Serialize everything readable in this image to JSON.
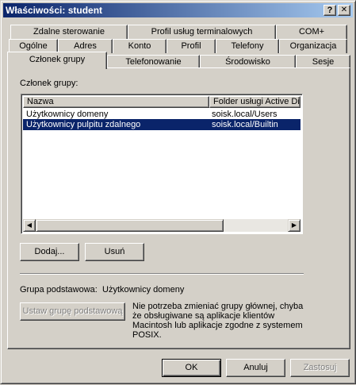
{
  "window": {
    "title": "Właściwości: student",
    "help_button": "?",
    "close_button": "✕"
  },
  "tabs": {
    "row1": [
      "Zdalne sterowanie",
      "Profil usług terminalowych",
      "COM+"
    ],
    "row2": [
      "Ogólne",
      "Adres",
      "Konto",
      "Profil",
      "Telefony",
      "Organizacja"
    ],
    "row3": [
      "Członek grupy",
      "Telefonowanie",
      "Środowisko",
      "Sesje"
    ],
    "active": "Członek grupy"
  },
  "member_of": {
    "label": "Członek grupy:",
    "columns": [
      "Nazwa",
      "Folder usługi Active Dire"
    ],
    "rows": [
      {
        "name": "Użytkownicy domeny",
        "folder": "soisk.local/Users",
        "selected": false
      },
      {
        "name": "Użytkownicy pulpitu zdalnego",
        "folder": "soisk.local/Builtin",
        "selected": true
      }
    ]
  },
  "buttons": {
    "add": "Dodaj...",
    "remove": "Usuń",
    "set_primary": "Ustaw grupę podstawową",
    "ok": "OK",
    "cancel": "Anuluj",
    "apply": "Zastosuj"
  },
  "primary_group": {
    "label": "Grupa podstawowa:",
    "value": "Użytkownicy domeny",
    "note": [
      "Nie potrzeba zmieniać grupy głównej, chyba",
      "że obsługiwane są aplikacje klientów",
      "Macintosh lub aplikacje zgodne z systemem",
      "POSIX."
    ]
  },
  "icons": {
    "scroll_left": "scroll-left-arrow-icon",
    "scroll_right": "scroll-right-arrow-icon"
  }
}
